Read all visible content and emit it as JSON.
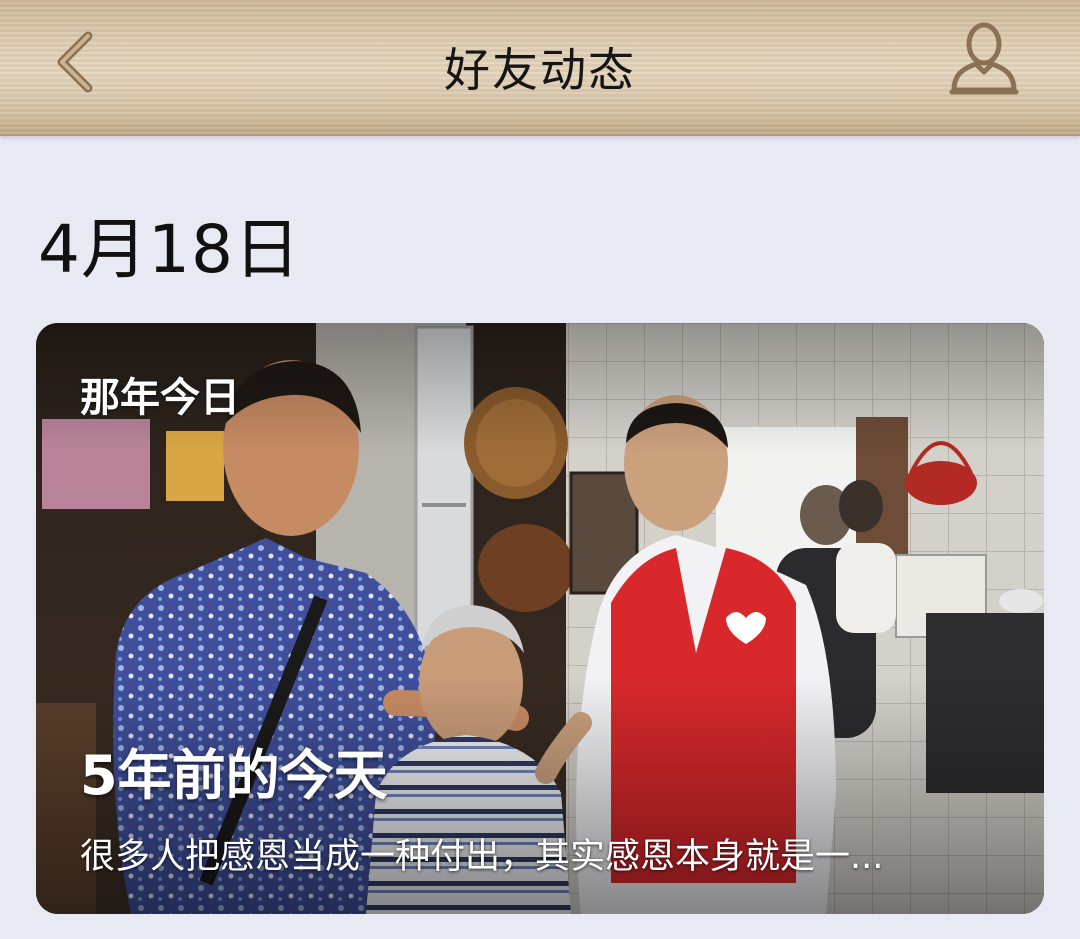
{
  "header": {
    "title": "好友动态",
    "back_icon": "chevron-left-icon",
    "profile_icon": "person-outline-icon"
  },
  "date": "4月18日",
  "memory_card": {
    "label": "那年今日",
    "title": "5年前的今天",
    "description": "很多人把感恩当成一种付出，其实感恩本身就是一..."
  },
  "colors": {
    "header_wood": "#dccab0",
    "page_background": "#e8eaf3",
    "vest_red": "#d8282c"
  }
}
